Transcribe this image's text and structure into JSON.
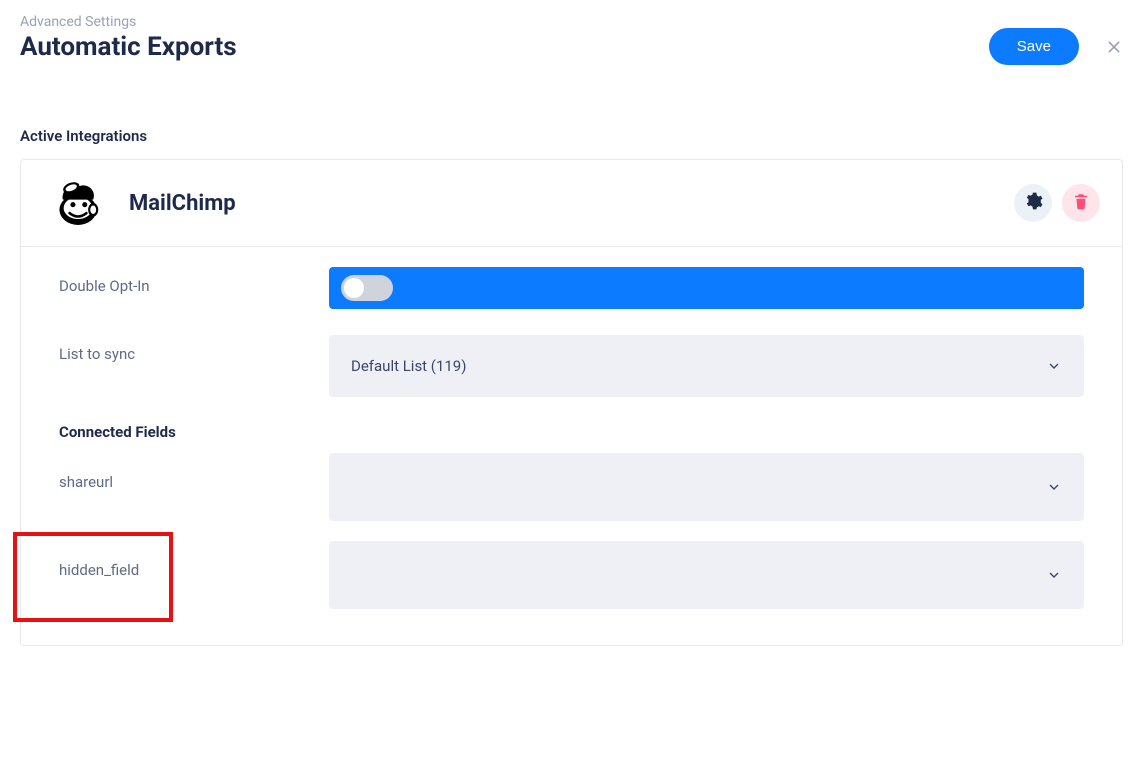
{
  "breadcrumb": "Advanced Settings",
  "page_title": "Automatic Exports",
  "save_label": "Save",
  "section_heading": "Active Integrations",
  "integration": {
    "name": "MailChimp",
    "settings": {
      "double_opt_in_label": "Double Opt-In",
      "list_label": "List to sync",
      "list_value": "Default List (119)",
      "connected_fields_heading": "Connected Fields",
      "fields": [
        {
          "label": "shareurl",
          "value": ""
        },
        {
          "label": "hidden_field",
          "value": ""
        }
      ]
    }
  }
}
